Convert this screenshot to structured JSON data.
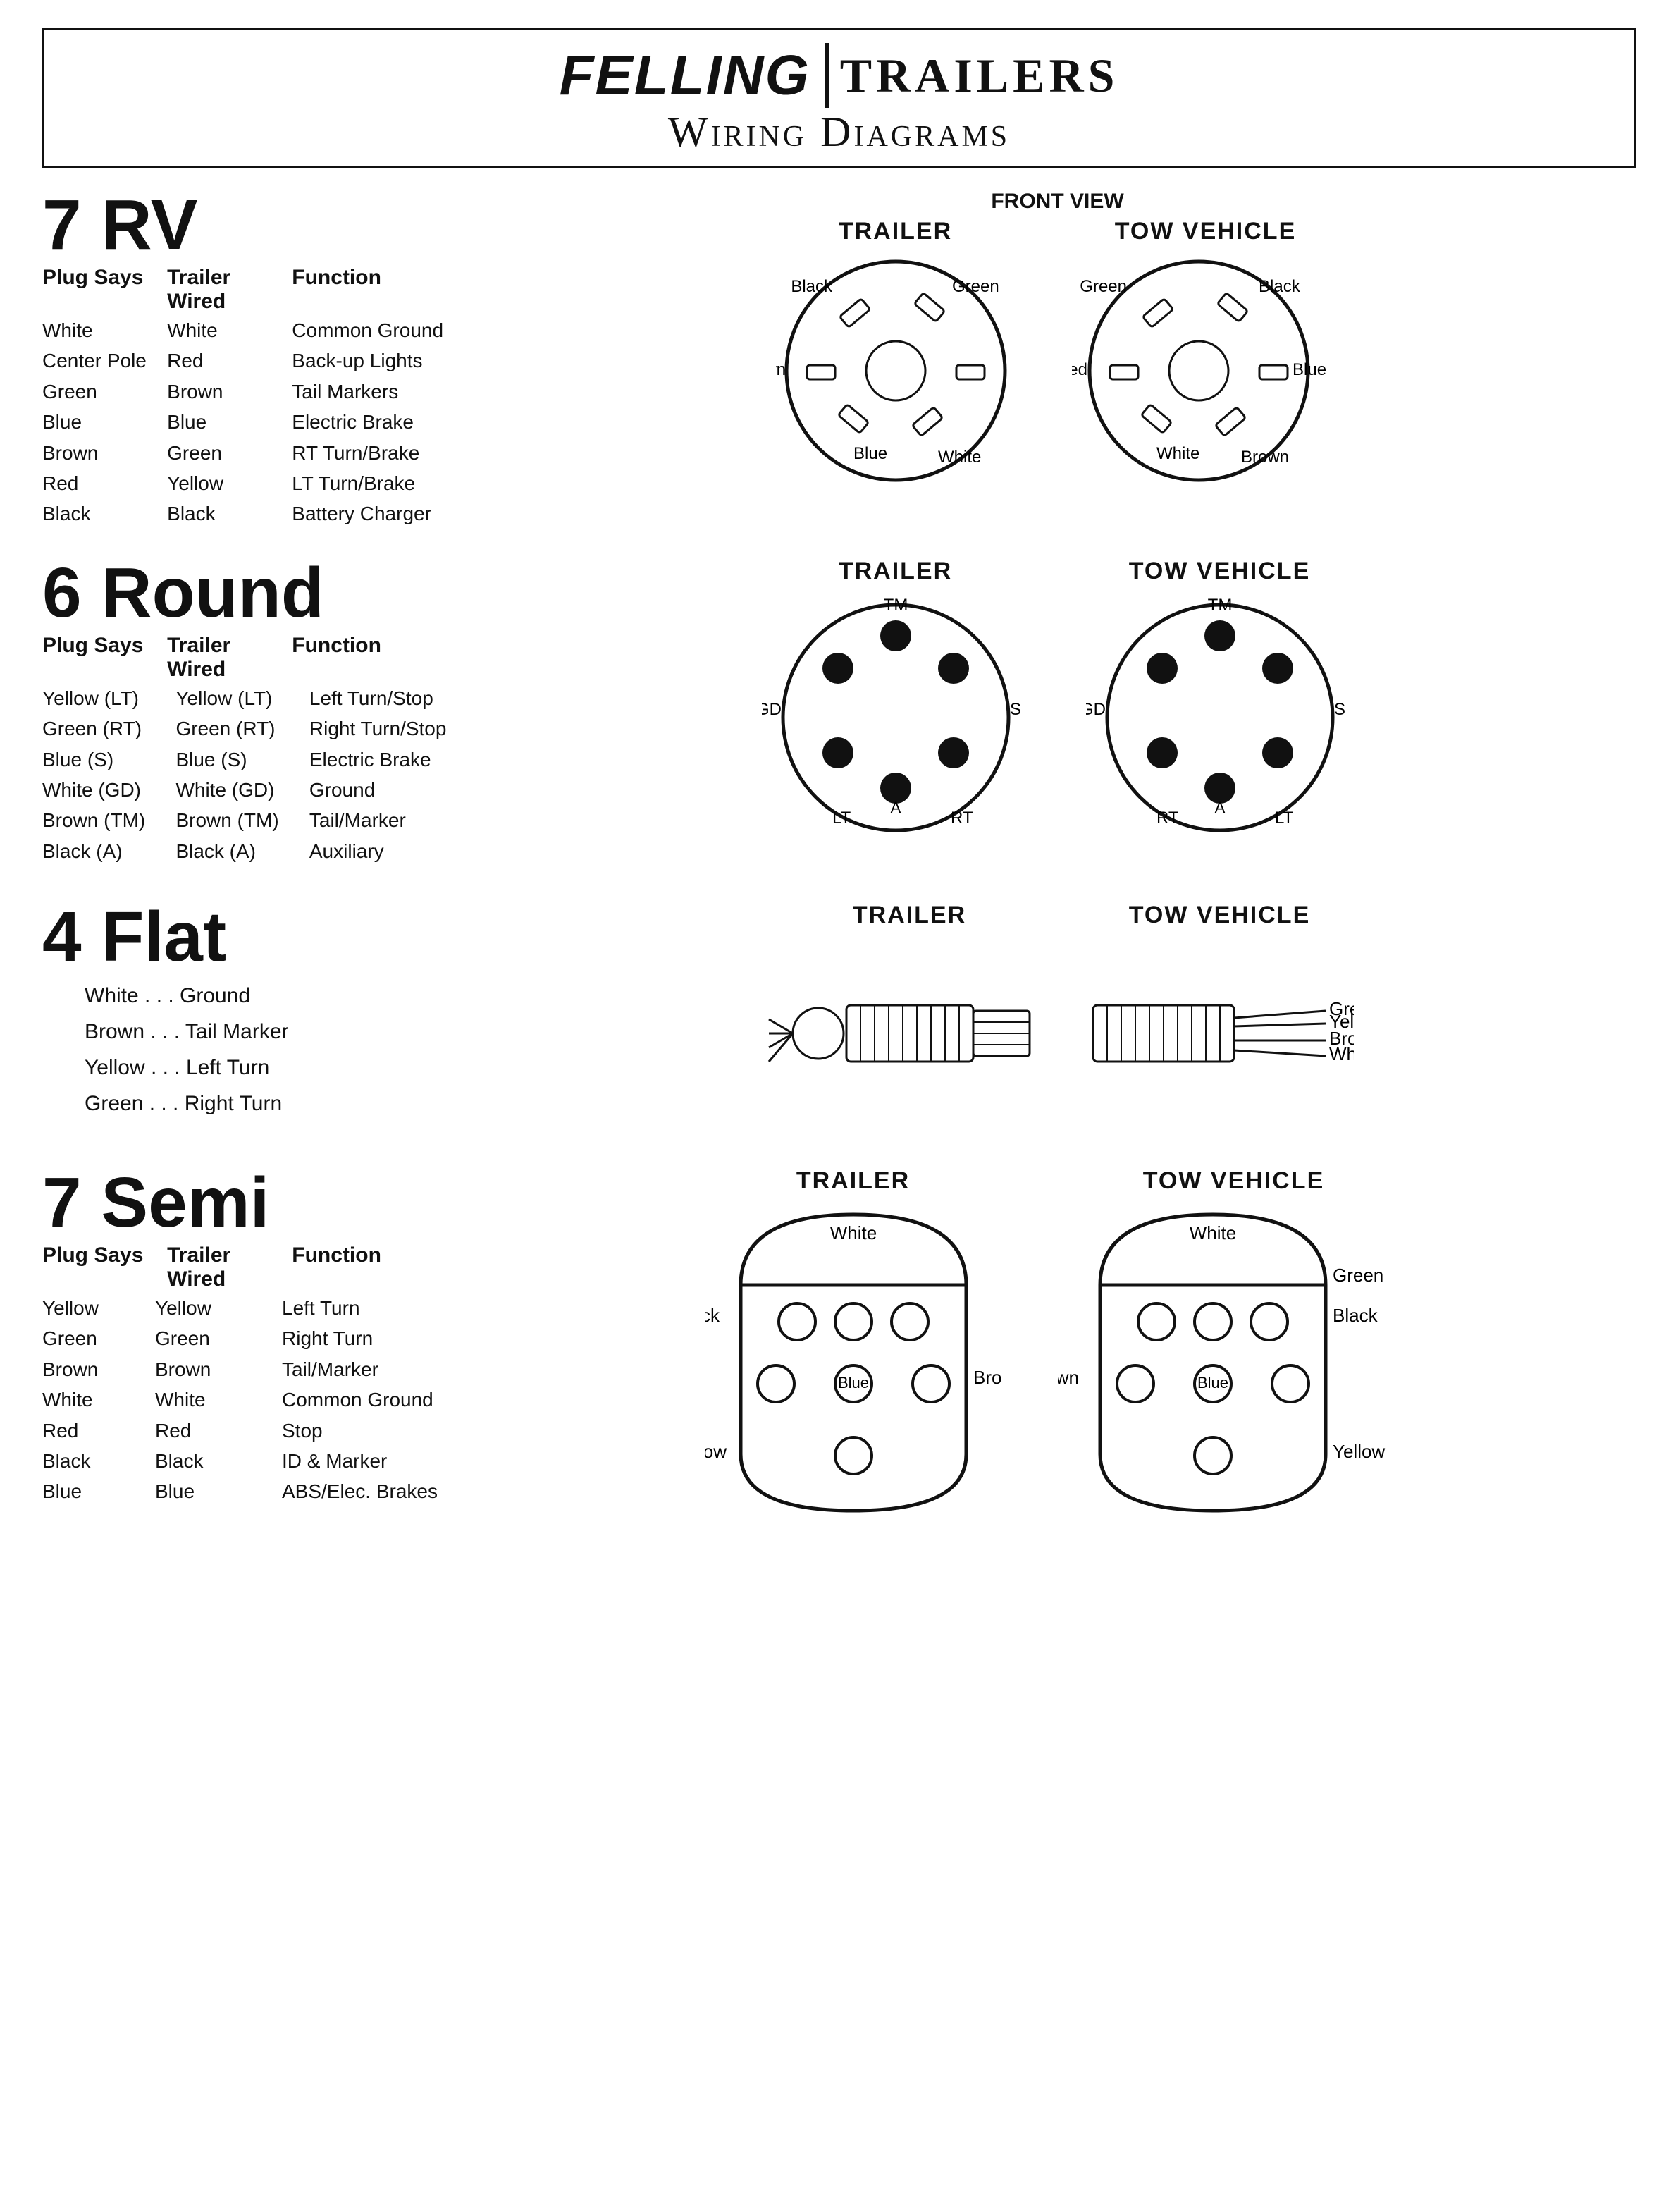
{
  "header": {
    "brand": "FELLING",
    "trailers": "TRAILERS",
    "subtitle": "Wiring Diagrams"
  },
  "front_view_label": "FRONT VIEW",
  "rv7": {
    "title": "7 RV",
    "col_plug": "Plug Says",
    "col_wired": "Trailer Wired",
    "col_func": "Function",
    "rows": [
      {
        "plug": "White",
        "wired": "White",
        "func": "Common Ground"
      },
      {
        "plug": "Center Pole",
        "wired": "Red",
        "func": "Back-up Lights"
      },
      {
        "plug": "Green",
        "wired": "Brown",
        "func": "Tail Markers"
      },
      {
        "plug": "Blue",
        "wired": "Blue",
        "func": "Electric Brake"
      },
      {
        "plug": "Brown",
        "wired": "Green",
        "func": "RT Turn/Brake"
      },
      {
        "plug": "Red",
        "wired": "Yellow",
        "func": "LT Turn/Brake"
      },
      {
        "plug": "Black",
        "wired": "Black",
        "func": "Battery Charger"
      }
    ],
    "trailer_label": "TRAILER",
    "tow_label": "TOW VEHICLE",
    "trailer_pins": {
      "top_left": "Black",
      "top_right": "Green",
      "left": "Brown",
      "bottom_left": "Blue",
      "bottom_right": "White"
    },
    "tow_pins": {
      "top_left": "Green",
      "top_right": "Black",
      "left": "Red",
      "bottom_left": "White",
      "bottom_right": "Brown",
      "right": "Blue"
    }
  },
  "round6": {
    "title": "6 Round",
    "col_plug": "Plug Says",
    "col_wired": "Trailer Wired",
    "col_func": "Function",
    "rows": [
      {
        "plug": "Yellow (LT)",
        "wired": "Yellow (LT)",
        "func": "Left Turn/Stop"
      },
      {
        "plug": "Green (RT)",
        "wired": "Green (RT)",
        "func": "Right Turn/Stop"
      },
      {
        "plug": "Blue (S)",
        "wired": "Blue (S)",
        "func": "Electric Brake"
      },
      {
        "plug": "White (GD)",
        "wired": "White (GD)",
        "func": "Ground"
      },
      {
        "plug": "Brown (TM)",
        "wired": "Brown (TM)",
        "func": "Tail/Marker"
      },
      {
        "plug": "Black (A)",
        "wired": "Black (A)",
        "func": "Auxiliary"
      }
    ],
    "trailer_label": "TRAILER",
    "tow_label": "TOW VEHICLE",
    "trailer_positions": {
      "top": "TM",
      "left": "GD",
      "bottom_left": "LT",
      "bottom_right": "RT",
      "right": "S",
      "center_bottom": "A"
    },
    "tow_positions": {
      "top": "TM",
      "left": "GD",
      "bottom_left": "RT",
      "bottom_right": "LT",
      "right": "S",
      "center_bottom": "A"
    }
  },
  "flat4": {
    "title": "4 Flat",
    "trailer_label": "TRAILER",
    "tow_label": "TOW VEHICLE",
    "items": [
      {
        "wire": "White",
        "dots": "...",
        "func": "Ground"
      },
      {
        "wire": "Brown",
        "dots": "...",
        "func": "Tail Marker"
      },
      {
        "wire": "Yellow",
        "dots": "...",
        "func": "Left Turn"
      },
      {
        "wire": "Green",
        "dots": "...",
        "func": "Right Turn"
      }
    ],
    "tow_labels": [
      "Green",
      "Yellow",
      "Brown",
      "White"
    ]
  },
  "semi7": {
    "title": "7 Semi",
    "col_plug": "Plug Says",
    "col_wired": "Trailer Wired",
    "col_func": "Function",
    "rows": [
      {
        "plug": "Yellow",
        "wired": "Yellow",
        "func": "Left Turn"
      },
      {
        "plug": "Green",
        "wired": "Green",
        "func": "Right Turn"
      },
      {
        "plug": "Brown",
        "wired": "Brown",
        "func": "Tail/Marker"
      },
      {
        "plug": "White",
        "wired": "White",
        "func": "Common Ground"
      },
      {
        "plug": "Red",
        "wired": "Red",
        "func": "Stop"
      },
      {
        "plug": "Black",
        "wired": "Black",
        "func": "ID  & Marker"
      },
      {
        "plug": "Blue",
        "wired": "Blue",
        "func": "ABS/Elec. Brakes"
      }
    ],
    "trailer_label": "TRAILER",
    "tow_label": "TOW VEHICLE",
    "trailer_labels": {
      "top": "White",
      "left": "Black",
      "center": "Blue",
      "bottom_left": "Yellow",
      "right_mid": "Brown"
    },
    "tow_labels": {
      "top": "White",
      "right": "Black",
      "center": "Blue",
      "bottom_right": "Yellow",
      "left_mid": "Brown",
      "right2": "Green"
    }
  }
}
